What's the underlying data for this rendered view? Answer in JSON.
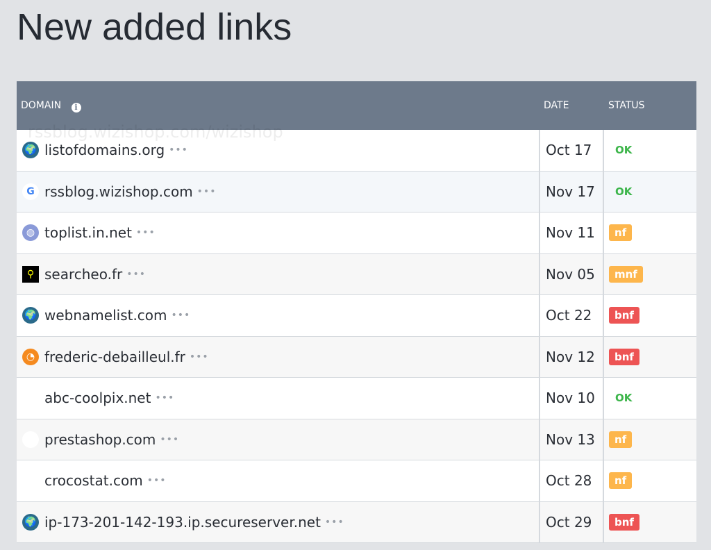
{
  "title": "New added links",
  "tooltip_ghost": "rssblog.wizishop.com/wizishop",
  "columns": {
    "domain": "DOMAIN",
    "date": "DATE",
    "status": "STATUS"
  },
  "status_colors": {
    "OK": "#3cb54a",
    "nf": "#fdb64c",
    "mnf": "#fdb64c",
    "bnf": "#ed5454"
  },
  "rows": [
    {
      "icon": "globe-icon",
      "domain": "listofdomains.org",
      "date": "Oct 17",
      "status": "OK"
    },
    {
      "icon": "google-icon",
      "domain": "rssblog.wizishop.com",
      "date": "Nov 17",
      "status": "OK"
    },
    {
      "icon": "globe-outline-icon",
      "domain": "toplist.in.net",
      "date": "Nov 11",
      "status": "nf"
    },
    {
      "icon": "magnifier-icon",
      "domain": "searcheo.fr",
      "date": "Nov 05",
      "status": "mnf"
    },
    {
      "icon": "globe-icon",
      "domain": "webnamelist.com",
      "date": "Oct 22",
      "status": "bnf"
    },
    {
      "icon": "rss-icon",
      "domain": "frederic-debailleul.fr",
      "date": "Nov 12",
      "status": "bnf"
    },
    {
      "icon": "camera-icon",
      "domain": "abc-coolpix.net",
      "date": "Nov 10",
      "status": "OK"
    },
    {
      "icon": "prestashop-icon",
      "domain": "prestashop.com",
      "date": "Nov 13",
      "status": "nf"
    },
    {
      "icon": "tag-icon",
      "domain": "crocostat.com",
      "date": "Oct 28",
      "status": "nf"
    },
    {
      "icon": "globe-icon",
      "domain": "ip-173-201-142-193.ip.secureserver.net",
      "date": "Oct 29",
      "status": "bnf"
    }
  ]
}
